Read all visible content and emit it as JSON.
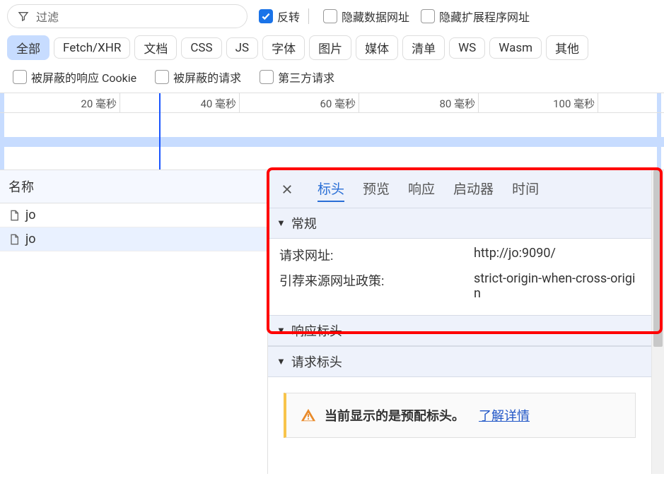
{
  "filter": {
    "placeholder": "过滤"
  },
  "topChecks": {
    "invert": "反转",
    "hideDataUrls": "隐藏数据网址",
    "hideExtUrls": "隐藏扩展程序网址"
  },
  "chips": [
    "全部",
    "Fetch/XHR",
    "文档",
    "CSS",
    "JS",
    "字体",
    "图片",
    "媒体",
    "清单",
    "WS",
    "Wasm",
    "其他"
  ],
  "row2Checks": {
    "blockedCookies": "被屏蔽的响应 Cookie",
    "blockedReq": "被屏蔽的请求",
    "thirdParty": "第三方请求"
  },
  "timeline": {
    "ticks": [
      "20 毫秒",
      "40 毫秒",
      "60 毫秒",
      "80 毫秒",
      "100 毫秒"
    ]
  },
  "names": {
    "header": "名称",
    "items": [
      "jo",
      "jo"
    ]
  },
  "detailsTabs": [
    "标头",
    "预览",
    "响应",
    "启动器",
    "时间"
  ],
  "sections": {
    "general": "常规",
    "respHeaders": "响应标头",
    "reqHeaders": "请求标头"
  },
  "general": {
    "reqUrlLabel": "请求网址:",
    "reqUrlValue": "http://jo:9090/",
    "refPolLabel": "引荐来源网址政策:",
    "refPolValue": "strict-origin-when-cross-origin"
  },
  "warnBox": {
    "msg": "当前显示的是预配标头。",
    "link": "了解详情"
  }
}
